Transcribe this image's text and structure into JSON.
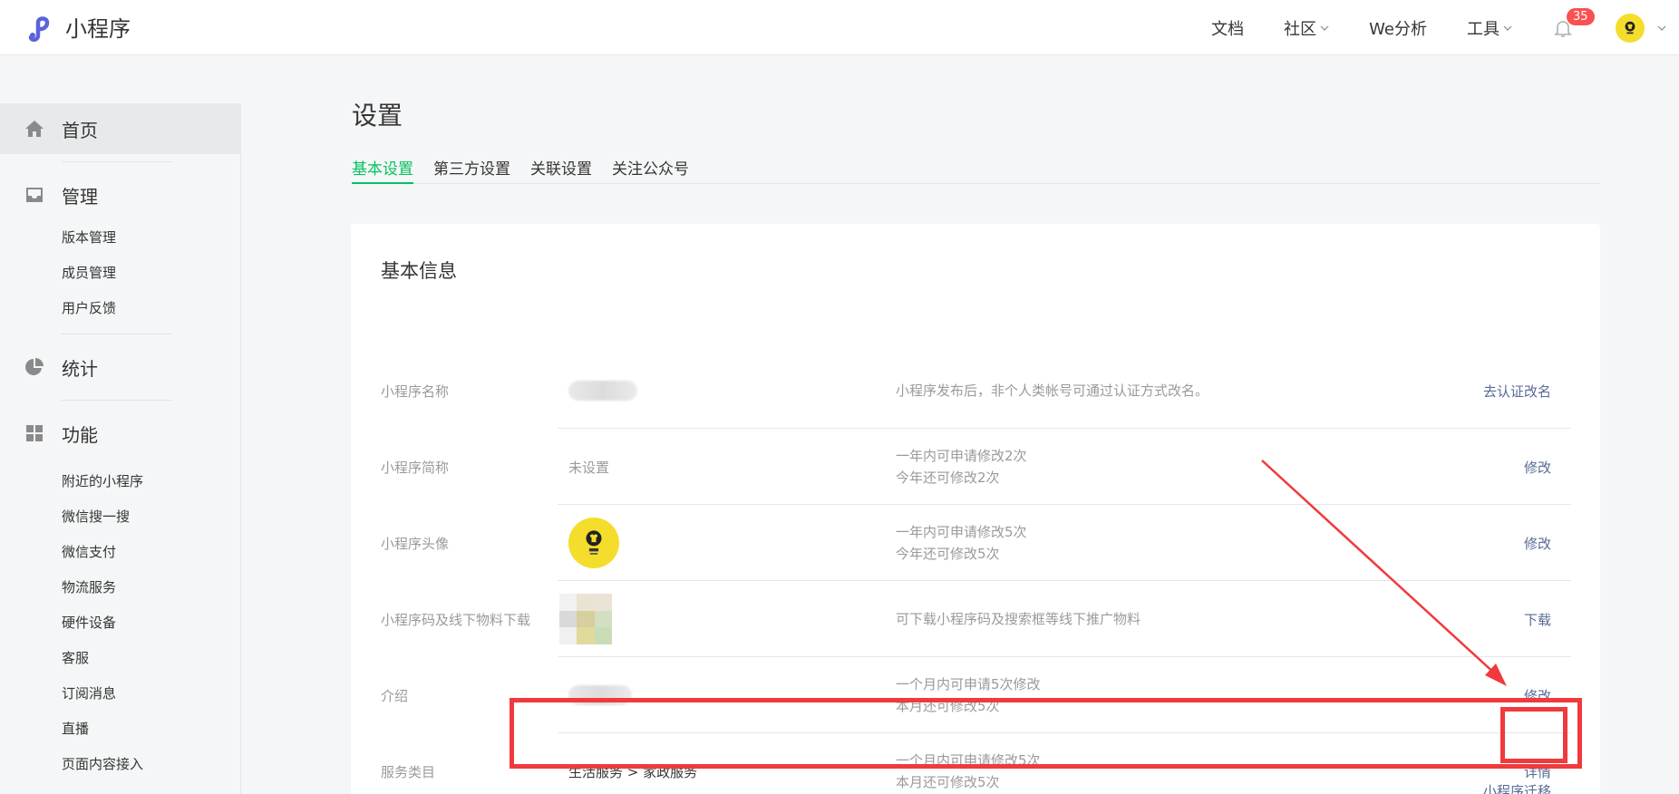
{
  "header": {
    "app_name": "小程序",
    "nav": [
      {
        "label": "文档",
        "has_dropdown": false
      },
      {
        "label": "社区",
        "has_dropdown": true
      },
      {
        "label": "We分析",
        "has_dropdown": false
      },
      {
        "label": "工具",
        "has_dropdown": true
      }
    ],
    "notification_count": "35",
    "colors": {
      "brand": "#5a63d8",
      "badge": "#fa5151"
    }
  },
  "sidebar": {
    "home": "首页",
    "manage": {
      "label": "管理",
      "items": [
        "版本管理",
        "成员管理",
        "用户反馈"
      ]
    },
    "stats": "统计",
    "features": {
      "label": "功能",
      "items": [
        "附近的小程序",
        "微信搜一搜",
        "微信支付",
        "物流服务",
        "硬件设备",
        "客服",
        "订阅消息",
        "直播",
        "页面内容接入"
      ]
    }
  },
  "page": {
    "title": "设置",
    "tabs": [
      "基本设置",
      "第三方设置",
      "关联设置",
      "关注公众号"
    ],
    "active_tab_color": "#07c160"
  },
  "card": {
    "title": "基本信息",
    "rows": [
      {
        "label": "小程序名称",
        "value": "",
        "desc": [
          "小程序发布后，非个人类帐号可通过认证方式改名。"
        ],
        "action": "去认证改名"
      },
      {
        "label": "小程序简称",
        "value": "未设置",
        "desc": [
          "一年内可申请修改2次",
          "今年还可修改2次"
        ],
        "action": "修改"
      },
      {
        "label": "小程序头像",
        "value": "",
        "desc": [
          "一年内可申请修改5次",
          "今年还可修改5次"
        ],
        "action": "修改"
      },
      {
        "label": "小程序码及线下物料下载",
        "value": "",
        "desc": [
          "可下载小程序码及搜索框等线下推广物料"
        ],
        "action": "下载"
      },
      {
        "label": "介绍",
        "value": "",
        "desc": [
          "一个月内可申请5次修改",
          "本月还可修改5次"
        ],
        "action": "修改"
      },
      {
        "label": "服务类目",
        "value": "生活服务 > 家政服务",
        "desc": [
          "一个月内可申请修改5次",
          "本月还可修改5次"
        ],
        "action": "详情"
      }
    ],
    "partial_action": "小程序迁移"
  },
  "annotation_color": "#f03a3d"
}
